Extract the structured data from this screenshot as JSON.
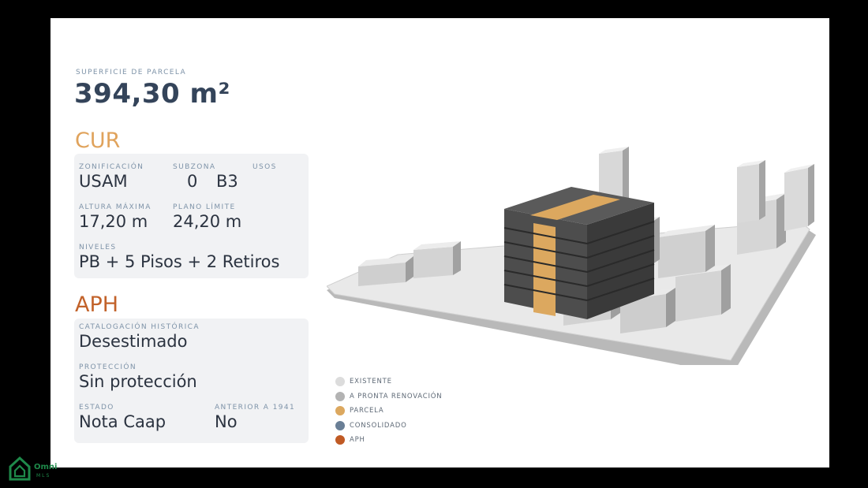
{
  "surface": {
    "label": "SUPERFICIE DE PARCELA",
    "value": "394,30 m²"
  },
  "cur": {
    "title": "CUR",
    "zonificacion": {
      "label": "ZONIFICACIÓN",
      "value": "USAM"
    },
    "subzona": {
      "label": "SUBZONA",
      "value": "0"
    },
    "usos": {
      "label": "USOS",
      "value": "B3"
    },
    "altura": {
      "label": "ALTURA MÁXIMA",
      "value": "17,20 m"
    },
    "plano": {
      "label": "PLANO LÍMITE",
      "value": "24,20 m"
    },
    "niveles": {
      "label": "NIVELES",
      "value": "PB + 5 Pisos + 2 Retiros"
    }
  },
  "aph": {
    "title": "APH",
    "catalogacion": {
      "label": "CATALOGACIÓN HISTÓRICA",
      "value": "Desestimado"
    },
    "proteccion": {
      "label": "PROTECCIÓN",
      "value": "Sin protección"
    },
    "estado": {
      "label": "ESTADO",
      "value": "Nota Caap"
    },
    "anterior": {
      "label": "ANTERIOR A 1941",
      "value": "No"
    }
  },
  "legend": [
    {
      "label": "EXISTENTE",
      "color": "#dcdcdc"
    },
    {
      "label": "A PRONTA RENOVACIÓN",
      "color": "#b3b3b3"
    },
    {
      "label": "PARCELA",
      "color": "#dca85f"
    },
    {
      "label": "CONSOLIDADO",
      "color": "#6a7f96"
    },
    {
      "label": "APH",
      "color": "#c05a24"
    }
  ],
  "logo": {
    "name": "Omni",
    "sub": "MLS"
  },
  "colors": {
    "cur_title": "#e0a35c",
    "aph_title": "#c2622a",
    "card_bg": "#f1f2f4"
  }
}
